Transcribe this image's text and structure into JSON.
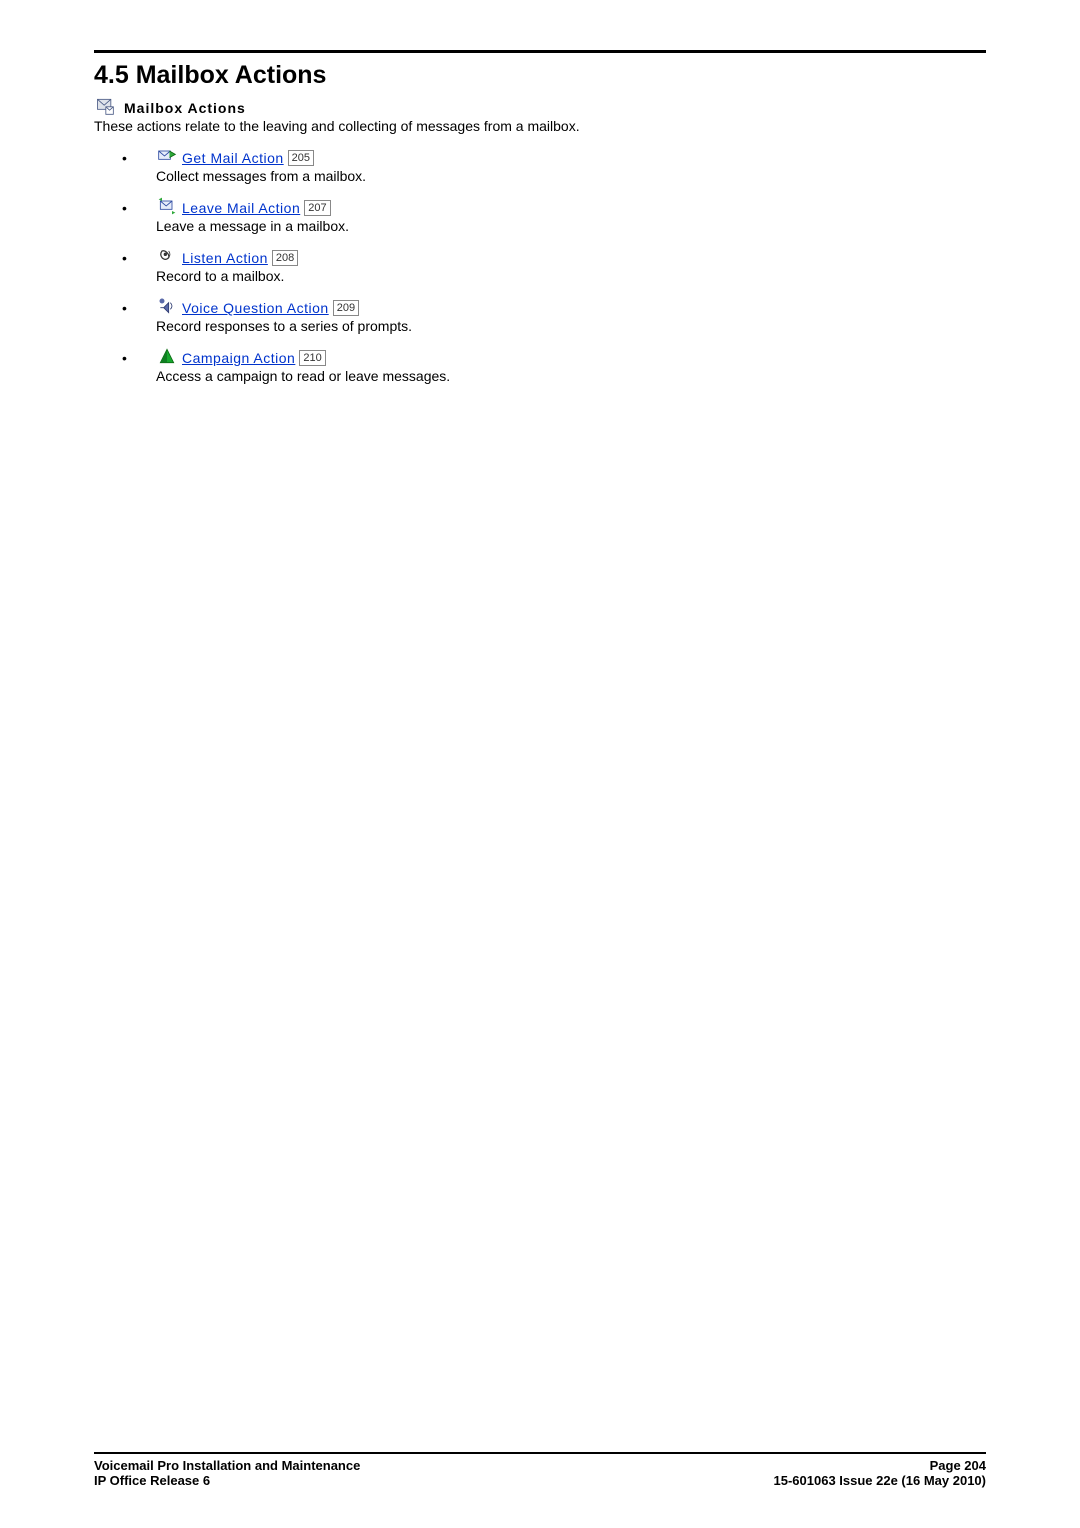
{
  "heading": "4.5 Mailbox Actions",
  "subtitle": "Mailbox Actions",
  "intro": "These actions relate to the leaving and collecting of messages from a mailbox.",
  "actions": [
    {
      "label": "Get Mail Action",
      "page": "205",
      "desc": "Collect messages from a mailbox."
    },
    {
      "label": "Leave Mail Action",
      "page": "207",
      "desc": "Leave a message in a mailbox."
    },
    {
      "label": "Listen Action",
      "page": "208",
      "desc": "Record to a mailbox."
    },
    {
      "label": "Voice Question Action",
      "page": "209",
      "desc": "Record responses to a series of prompts."
    },
    {
      "label": "Campaign Action",
      "page": "210",
      "desc": "Access a campaign to read or leave messages."
    }
  ],
  "footer": {
    "left1": "Voicemail Pro Installation and Maintenance",
    "left2": "IP Office Release 6",
    "right1": "Page 204",
    "right2": "15-601063 Issue 22e (16 May 2010)"
  }
}
